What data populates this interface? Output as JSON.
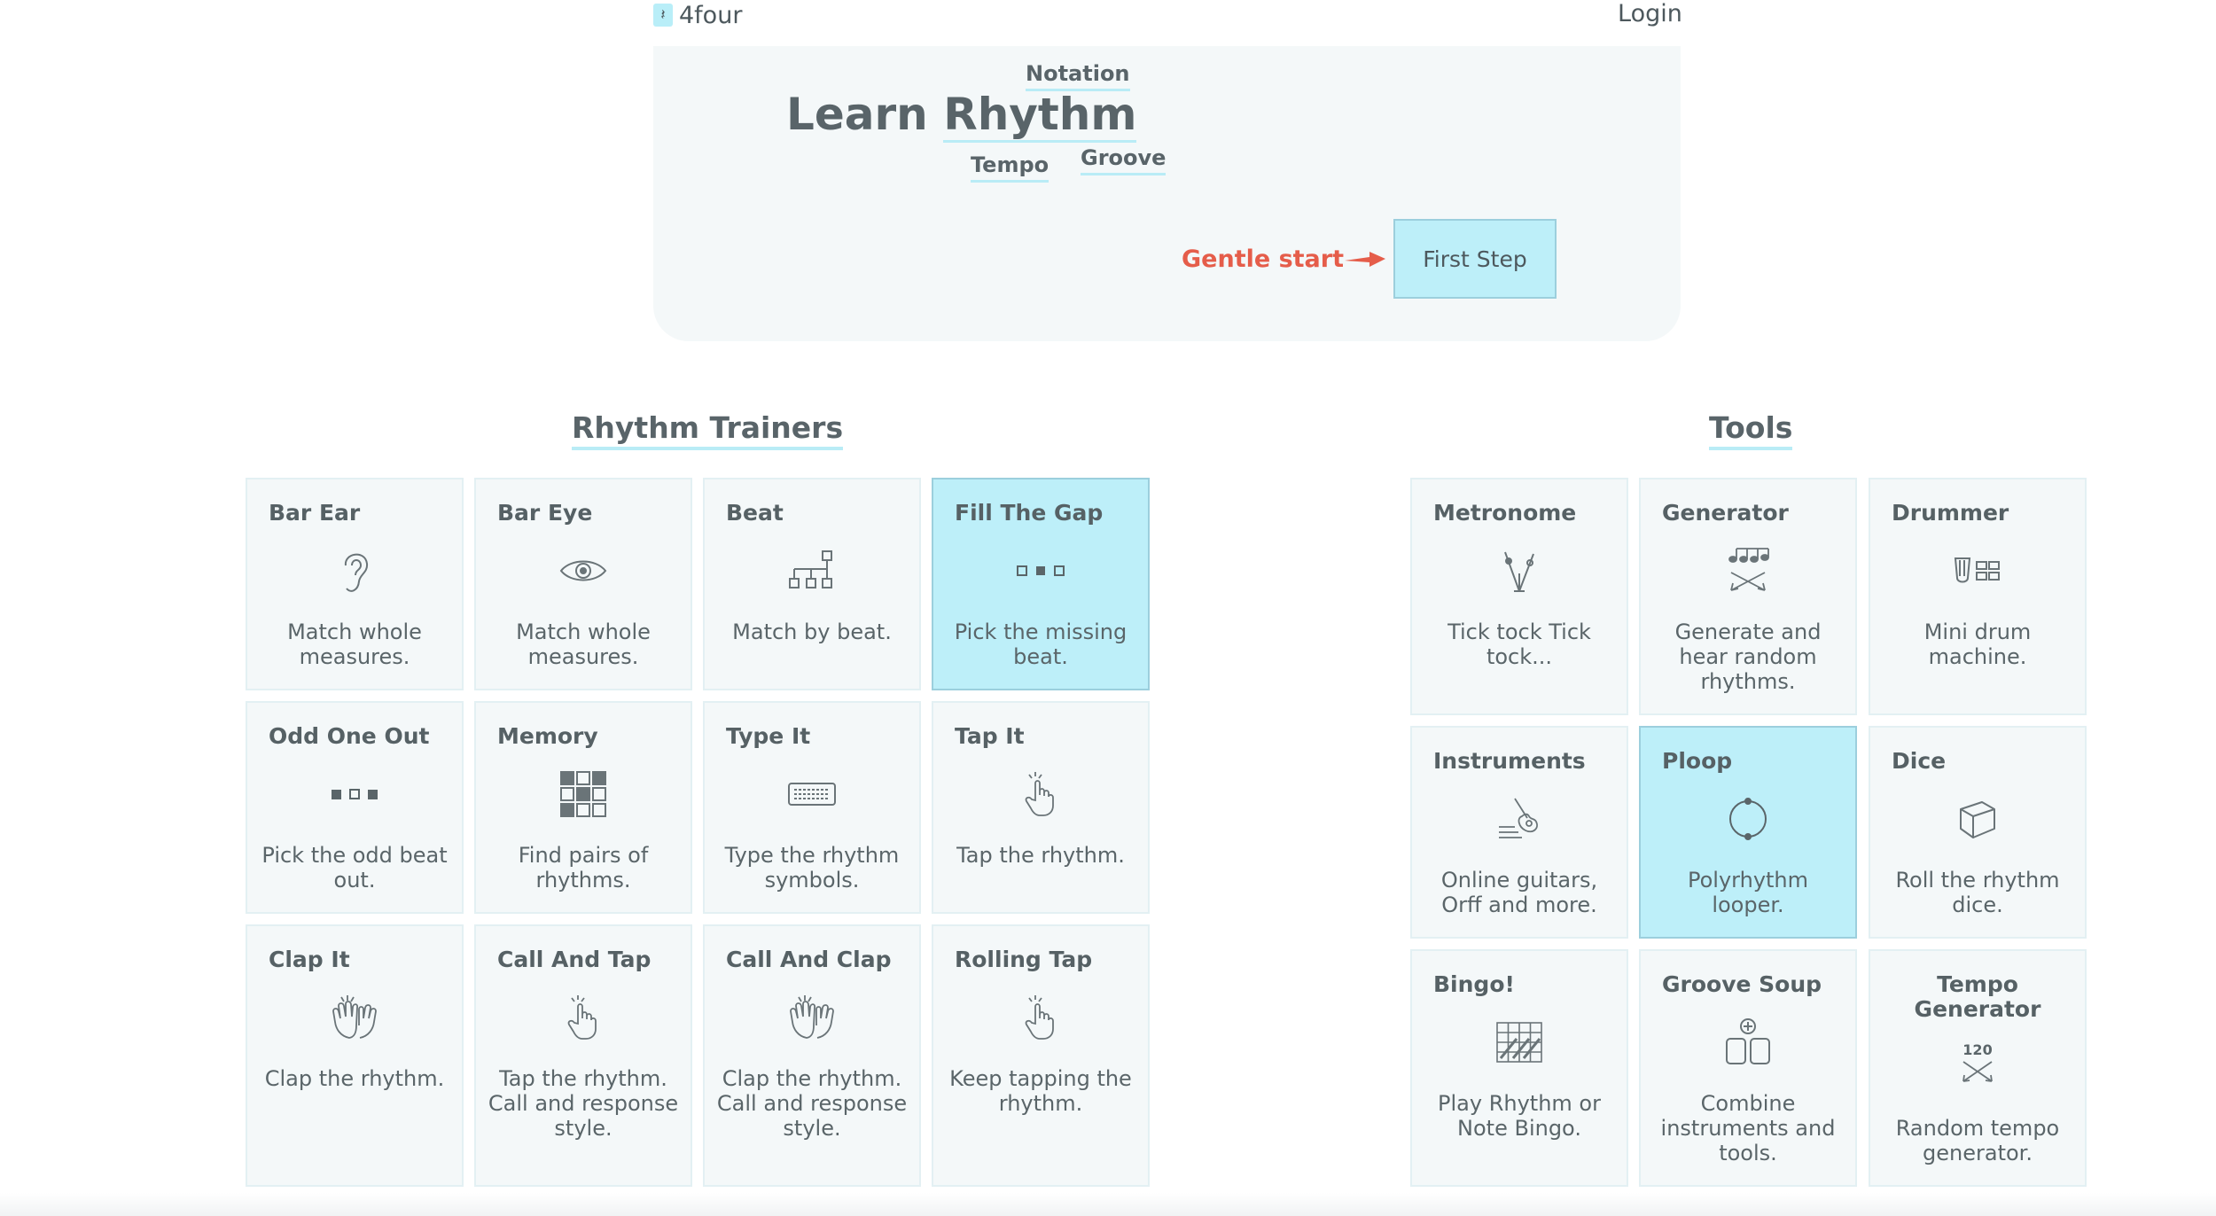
{
  "topbar": {
    "logo_glyph": "𝄽",
    "brand": "4four",
    "login": "Login"
  },
  "hero": {
    "title_prefix": "Learn",
    "title_word": "Rhythm",
    "words": [
      "Notation",
      "Tempo",
      "Groove"
    ],
    "gentle_start": "Gentle start",
    "first_step": "First Step"
  },
  "trainers": {
    "heading": "Rhythm Trainers",
    "cards": [
      {
        "title": "Bar Ear",
        "icon": "ear-icon",
        "desc": "Match whole measures."
      },
      {
        "title": "Bar Eye",
        "icon": "eye-icon",
        "desc": "Match whole measures."
      },
      {
        "title": "Beat",
        "icon": "beat-tree-icon",
        "desc": "Match by beat."
      },
      {
        "title": "Fill The Gap",
        "icon": "gap-squares-icon",
        "desc": "Pick the missing beat.",
        "active": true
      },
      {
        "title": "Odd One Out",
        "icon": "odd-squares-icon",
        "desc": "Pick the odd beat out."
      },
      {
        "title": "Memory",
        "icon": "memory-grid-icon",
        "desc": "Find pairs of rhythms."
      },
      {
        "title": "Type It",
        "icon": "keyboard-icon",
        "desc": "Type the rhythm symbols."
      },
      {
        "title": "Tap It",
        "icon": "tap-hand-icon",
        "desc": "Tap the rhythm."
      },
      {
        "title": "Clap It",
        "icon": "clap-hands-icon",
        "desc": "Clap the rhythm."
      },
      {
        "title": "Call And Tap",
        "icon": "tap-hand-icon",
        "desc": "Tap the rhythm. Call and response style."
      },
      {
        "title": "Call And Clap",
        "icon": "clap-hands-icon",
        "desc": "Clap the rhythm. Call and response style."
      },
      {
        "title": "Rolling Tap",
        "icon": "tap-hand-icon",
        "desc": "Keep tapping the rhythm."
      }
    ]
  },
  "tools": {
    "heading": "Tools",
    "cards": [
      {
        "title": "Metronome",
        "icon": "metronome-icon",
        "desc": "Tick tock Tick tock..."
      },
      {
        "title": "Generator",
        "icon": "generator-icon",
        "desc": "Generate and hear random rhythms."
      },
      {
        "title": "Drummer",
        "icon": "drum-machine-icon",
        "desc": "Mini drum machine."
      },
      {
        "title": "Instruments",
        "icon": "guitar-icon",
        "desc": "Online guitars, Orff and more."
      },
      {
        "title": "Ploop",
        "icon": "loop-circle-icon",
        "desc": "Polyrhythm looper.",
        "active": true
      },
      {
        "title": "Dice",
        "icon": "dice-icon",
        "desc": "Roll the rhythm dice."
      },
      {
        "title": "Bingo!",
        "icon": "bingo-card-icon",
        "desc": "Play Rhythm or Note Bingo."
      },
      {
        "title": "Groove Soup",
        "icon": "groove-soup-icon",
        "desc": "Combine instruments and tools."
      },
      {
        "title": "Tempo Generator",
        "icon": "tempo-generator-icon",
        "icon_text": "120",
        "desc": "Random tempo generator."
      }
    ]
  },
  "colors": {
    "accent": "#bdeff9",
    "underline": "#b9ecf6",
    "gentle": "#e55d4a",
    "text": "#566165",
    "card_bg": "#f4f8f9"
  }
}
